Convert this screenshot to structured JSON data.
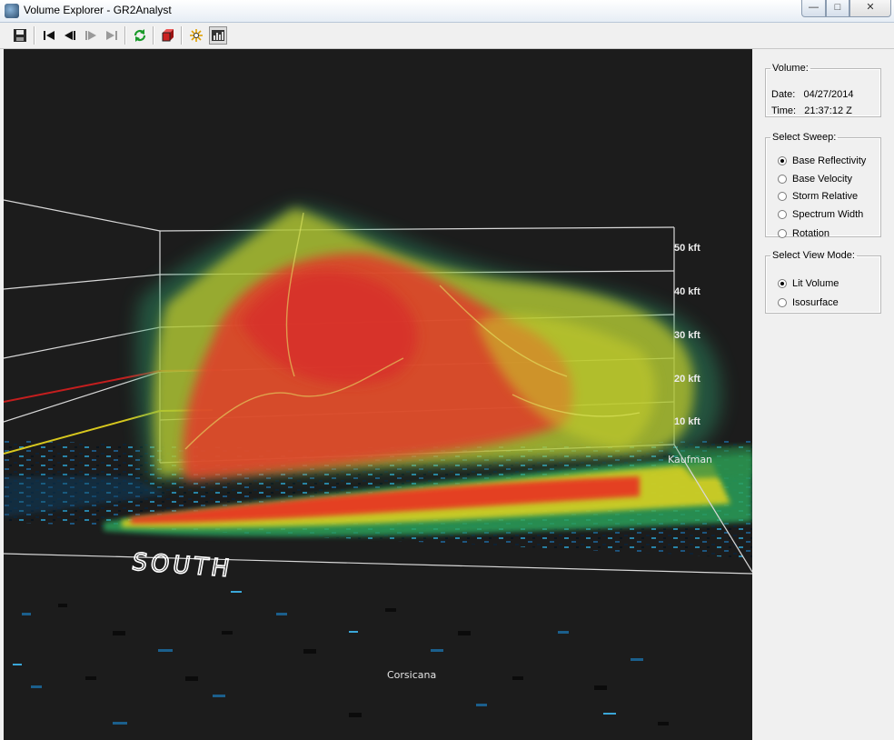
{
  "window": {
    "title": "Volume Explorer - GR2Analyst"
  },
  "toolbar": {
    "icons": [
      "save-icon",
      "first-frame-icon",
      "previous-frame-icon",
      "next-frame-icon",
      "last-frame-icon",
      "refresh-icon",
      "volume-cube-icon",
      "sparkle-icon",
      "chart-icon"
    ]
  },
  "view": {
    "height_labels": [
      "50 kft",
      "40 kft",
      "30 kft",
      "20 kft",
      "10 kft"
    ],
    "direction_label": "SOUTH",
    "places": [
      "Kaufman",
      "Corsicana"
    ],
    "colors": {
      "background": "#1c1c1c",
      "core": "#e23a2a",
      "envelope": "#c8cf2a",
      "outer": "#2d9a6a",
      "grid": "#d8d8d8"
    }
  },
  "volume": {
    "legend": "Volume:",
    "date_label": "Date:",
    "date": "04/27/2014",
    "time_label": "Time:",
    "time": "21:37:12 Z"
  },
  "sweep": {
    "legend": "Select Sweep:",
    "options": [
      {
        "label": "Base Reflectivity",
        "selected": true
      },
      {
        "label": "Base Velocity",
        "selected": false
      },
      {
        "label": "Storm Relative",
        "selected": false
      },
      {
        "label": "Spectrum Width",
        "selected": false
      },
      {
        "label": "Rotation",
        "selected": false
      }
    ]
  },
  "mode": {
    "legend": "Select View Mode:",
    "options": [
      {
        "label": "Lit Volume",
        "selected": true
      },
      {
        "label": "Isosurface",
        "selected": false
      }
    ]
  }
}
